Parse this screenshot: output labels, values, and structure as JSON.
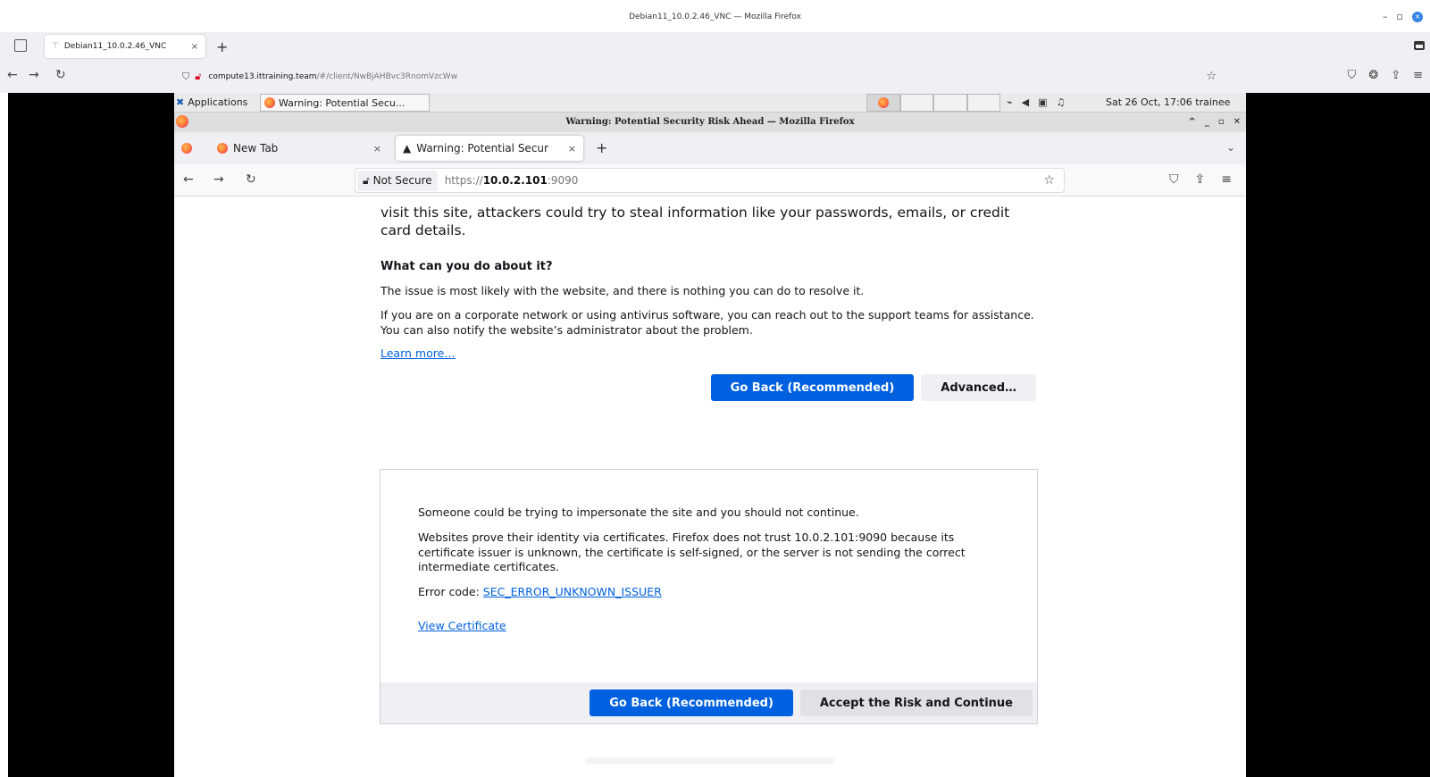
{
  "outer": {
    "window_title": "Debian11_10.0.2.46_VNC — Mozilla Firefox",
    "tab_label": "Debian11_10.0.2.46_VNC",
    "url_host": "compute13.ittraining.team",
    "url_path": "/#/client/NwBjAHBvc3RnomVzcWw"
  },
  "remote_panel": {
    "applications": "Applications",
    "task_label": "Warning: Potential Secu...",
    "clock": "Sat 26 Oct, 17:06",
    "user": "trainee"
  },
  "remote_window": {
    "title": "Warning: Potential Security Risk Ahead — Mozilla Firefox"
  },
  "remote_tabs": [
    {
      "label": "New Tab"
    },
    {
      "label": "Warning: Potential Secur"
    }
  ],
  "remote_nav": {
    "not_secure": "Not Secure",
    "url_scheme": "https://",
    "url_host": "10.0.2.101",
    "url_port": ":9090"
  },
  "page": {
    "lead": "visit this site, attackers could try to steal information like your passwords, emails, or credit card details.",
    "what_heading": "What can you do about it?",
    "para1": "The issue is most likely with the website, and there is nothing you can do to resolve it.",
    "para2": "If you are on a corporate network or using antivirus software, you can reach out to the support teams for assistance. You can also notify the website’s administrator about the problem.",
    "learn_more": "Learn more…",
    "go_back": "Go Back (Recommended)",
    "advanced": "Advanced…"
  },
  "advanced_panel": {
    "line1": "Someone could be trying to impersonate the site and you should not continue.",
    "line2": "Websites prove their identity via certificates. Firefox does not trust 10.0.2.101:9090 because its certificate issuer is unknown, the certificate is self-signed, or the server is not sending the correct intermediate certificates.",
    "error_prefix": "Error code: ",
    "error_code": "SEC_ERROR_UNKNOWN_ISSUER",
    "view_cert": "View Certificate",
    "go_back": "Go Back (Recommended)",
    "accept": "Accept the Risk and Continue"
  }
}
